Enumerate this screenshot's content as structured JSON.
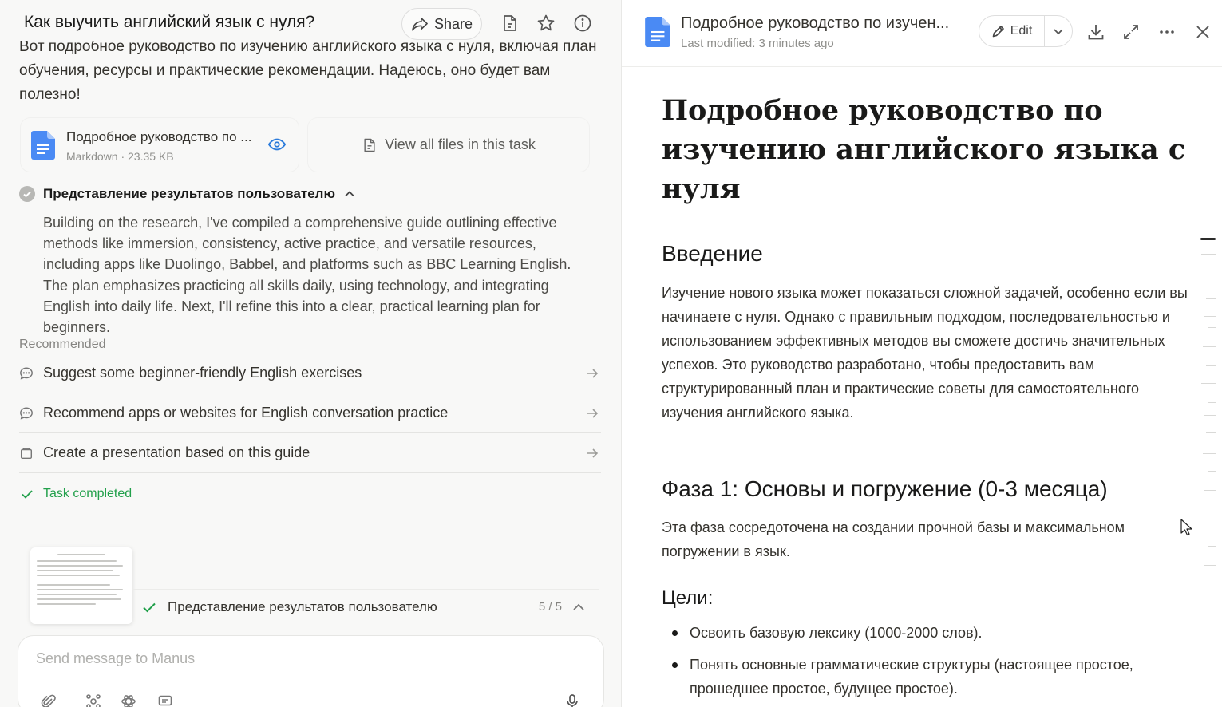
{
  "left": {
    "task_title": "Как выучить английский язык с нуля?",
    "share_label": "Share",
    "intro_text": "Вот подробное руководство по изучению английского языка с нуля, включая план обучения, ресурсы и практические рекомендации. Надеюсь, оно будет вам полезно!",
    "file_card": {
      "name": "Подробное руководство по ...",
      "meta": "Markdown · 23.35 KB"
    },
    "view_all_label": "View all files in this task",
    "step": {
      "title": "Представление результатов пользователю",
      "body": "Building on the research, I've compiled a comprehensive guide outlining effective methods like immersion, consistency, active practice, and versatile resources, including apps like Duolingo, Babbel, and platforms such as BBC Learning English. The plan emphasizes practicing all skills daily, using technology, and integrating English into daily life. Next, I'll refine this into a clear, practical learning plan for beginners."
    },
    "recommended_label": "Recommended",
    "recommended": [
      {
        "label": "Suggest some beginner-friendly English exercises",
        "icon": "chat-icon"
      },
      {
        "label": "Recommend apps or websites for English conversation practice",
        "icon": "chat-icon"
      },
      {
        "label": "Create a presentation based on this guide",
        "icon": "presentation-icon"
      }
    ],
    "task_completed": "Task completed",
    "progress": {
      "title": "Представление результатов пользователю",
      "count": "5 / 5"
    },
    "composer_placeholder": "Send message to Manus"
  },
  "right": {
    "doc_title": "Подробное руководство по изучен...",
    "last_modified": "Last modified: 3 minutes ago",
    "edit_label": "Edit",
    "h1": "Подробное руководство по изучению английского языка с нуля",
    "intro_heading": "Введение",
    "intro_paragraph": "Изучение нового языка может показаться сложной задачей, особенно если вы начинаете с нуля. Однако с правильным подходом, последовательностью и использованием эффективных методов вы сможете достичь значительных успехов. Это руководство разработано, чтобы предоставить вам структурированный план и практические советы для самостоятельного изучения английского языка.",
    "phase1_heading": "Фаза 1: Основы и погружение (0-3 месяца)",
    "phase1_paragraph": "Эта фаза сосредоточена на создании прочной базы и максимальном погружении в язык.",
    "goals_heading": "Цели:",
    "goals": [
      "Освоить базовую лексику (1000-2000 слов).",
      "Понять основные грамматические структуры (настоящее простое, прошедшее простое, будущее простое)."
    ]
  },
  "colors": {
    "accent_blue": "#2b7bdb",
    "success_green": "#22a04b",
    "doc_icon_blue": "#4a8af4"
  }
}
